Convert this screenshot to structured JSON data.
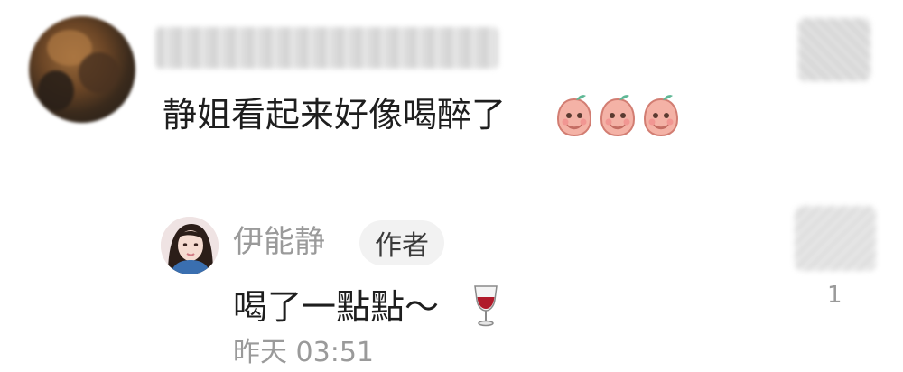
{
  "comment": {
    "text": "静姐看起来好像喝醉了",
    "emoji_icons": [
      "peach-face-emoji-icon",
      "peach-face-emoji-icon",
      "peach-face-emoji-icon"
    ]
  },
  "reply": {
    "username": "伊能静",
    "author_badge": "作者",
    "text": "喝了一點點～",
    "trailing_icon": "wine-glass-icon",
    "timestamp": "昨天 03:51",
    "like_count": "1"
  },
  "colors": {
    "primary_text": "#1e1e1e",
    "secondary_text": "#9a9a9a",
    "badge_bg": "#f2f2f2"
  }
}
